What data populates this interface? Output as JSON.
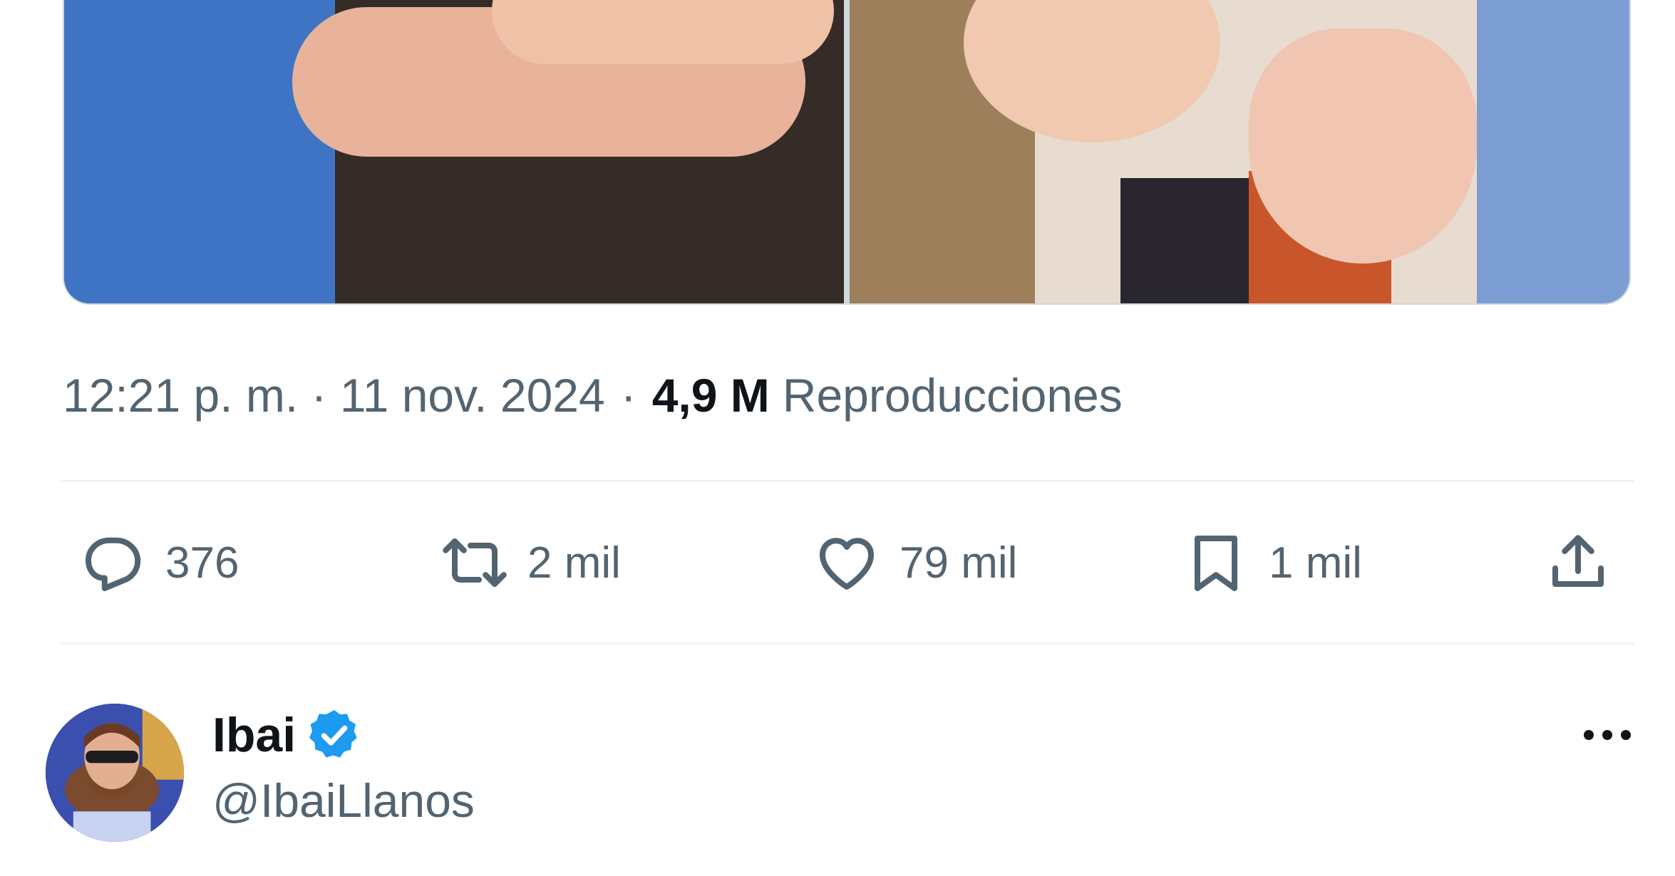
{
  "tweet": {
    "timestamp": "12:21 p. m. · 11 nov. 2024",
    "separator": "·",
    "views_count": "4,9 M",
    "views_label": "Reproducciones"
  },
  "actions": {
    "reply": {
      "icon": "reply-icon",
      "count": "376"
    },
    "retweet": {
      "icon": "retweet-icon",
      "count": "2 mil"
    },
    "like": {
      "icon": "heart-icon",
      "count": "79 mil"
    },
    "bookmark": {
      "icon": "bookmark-icon",
      "count": "1 mil"
    },
    "share": {
      "icon": "share-icon"
    }
  },
  "author": {
    "name": "Ibai",
    "handle": "@IbaiLlanos",
    "verified": true
  },
  "colors": {
    "text_primary": "#0f1419",
    "text_secondary": "#536471",
    "verified_blue": "#1d9bf0",
    "divider": "#eff3f4"
  }
}
